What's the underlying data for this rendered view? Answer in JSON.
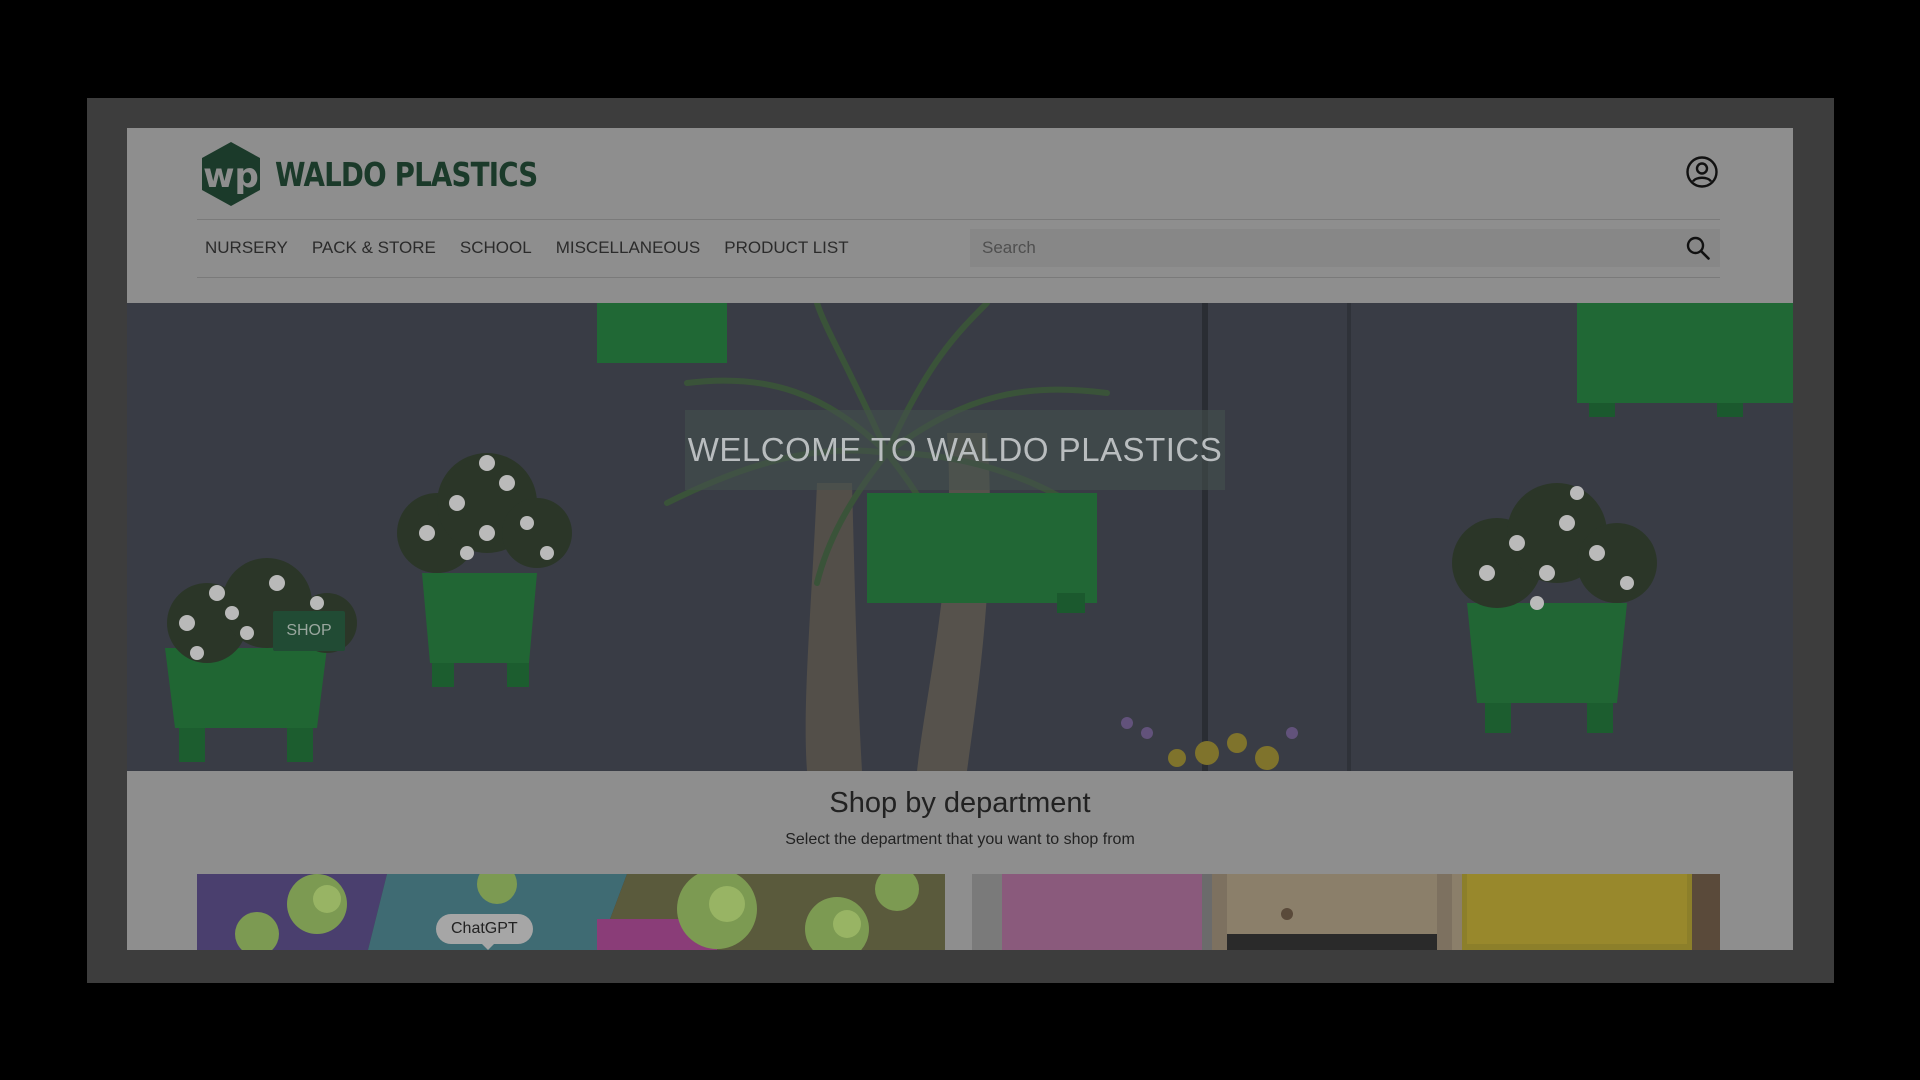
{
  "brand": {
    "name": "WALDO PLASTICS",
    "color": "#1b3a2a"
  },
  "nav": {
    "items": [
      {
        "label": "NURSERY"
      },
      {
        "label": "PACK & STORE"
      },
      {
        "label": "SCHOOL"
      },
      {
        "label": "MISCELLANEOUS"
      },
      {
        "label": "PRODUCT LIST"
      }
    ]
  },
  "search": {
    "placeholder": "Search",
    "value": ""
  },
  "icons": {
    "account": "user-circle-icon",
    "search": "magnifier-icon"
  },
  "hero": {
    "title": "WELCOME TO WALDO PLASTICS",
    "shop_label": "SHOP",
    "accent": "#214b34"
  },
  "department": {
    "title": "Shop by department",
    "subtitle": "Select the department that you want to shop from"
  },
  "tooltip": {
    "label": "ChatGPT"
  }
}
